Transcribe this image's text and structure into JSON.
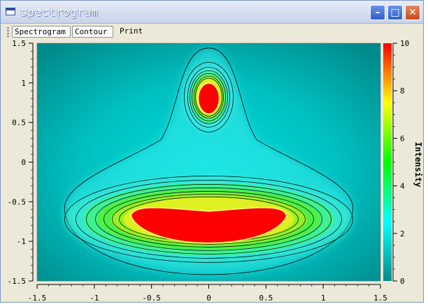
{
  "window": {
    "title": "spectrogram"
  },
  "toolbar": {
    "spectrogram_label": "Spectrogram",
    "contour_label": "Contour",
    "print_label": "Print"
  },
  "chart_data": {
    "type": "heatmap",
    "title": "",
    "xlabel": "",
    "ylabel": "",
    "xlim": [
      -1.5,
      1.5
    ],
    "ylim": [
      -1.5,
      1.5
    ],
    "x_ticks": [
      "-1.5",
      "-1",
      "-0.5",
      "0",
      "0.5",
      "1",
      "1.5"
    ],
    "y_ticks": [
      "1.5",
      "1",
      "0.5",
      "0",
      "-0.5",
      "-1",
      "-1.5"
    ],
    "colorbar": {
      "label": "Intensity",
      "range": [
        0,
        10
      ],
      "ticks": [
        "10",
        "8",
        "6",
        "4",
        "2",
        "0"
      ],
      "colors": [
        "#008b8b",
        "#00ffff",
        "#00ff00",
        "#ffff00",
        "#ff0000"
      ]
    },
    "regions": [
      {
        "name": "upper peak",
        "center": [
          0.0,
          0.82
        ],
        "value": 10
      },
      {
        "name": "lower arc",
        "center": [
          0.0,
          -0.72
        ],
        "value": 10
      }
    ],
    "contour_levels": [
      1,
      2,
      3,
      4,
      5,
      6,
      7,
      8,
      9
    ]
  }
}
